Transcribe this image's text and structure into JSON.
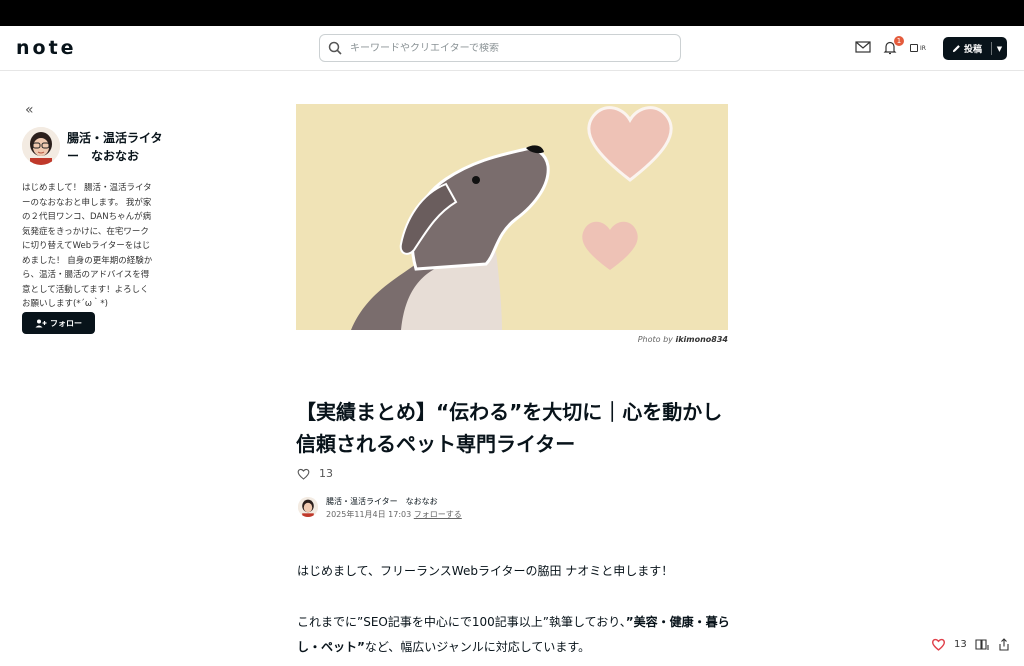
{
  "header": {
    "logo": "note",
    "search_placeholder": "キーワードやクリエイターで検索",
    "notification_count": "1",
    "account_label": "IR",
    "post_label": "投稿"
  },
  "profile": {
    "name": "腸活・温活ライター　なおなお",
    "bio": "はじめまして！ 腸活・温活ライターのなおなおと申します。 我が家の２代目ワンコ、DANちゃんが病気発症をきっかけに、在宅ワークに切り替えてWebライターをはじめました！ 自身の更年期の経験から、温活・腸活のアドバイスを得意として活動してます！よろしくお願いします(*´ω｀*)",
    "follow_label": "フォロー"
  },
  "article": {
    "photo_credit_prefix": "Photo by",
    "photo_credit_user": "ikimono834",
    "title": "【実績まとめ】“伝わる”を大切に｜心を動かし信頼されるペット専門ライター",
    "like_count": "13",
    "author_name": "腸活・温活ライター　なおなお",
    "date": "2025年11月4日 17:03",
    "follow_link": "フォローする",
    "para1": "はじめまして、フリーランスWebライターの脇田 ナオミと申します！",
    "para2_a": "これまでに”SEO記事を中心にで100記事以上”執筆しており、",
    "para2_b": "”美容・健康・暮らし・ペット”",
    "para2_c": "など、幅広いジャンルに対応しています。"
  },
  "floating": {
    "like_count": "13"
  },
  "colors": {
    "hero_bg": "#f0e3b6",
    "dog": "#7a6d6d",
    "heart": "#eec2b6",
    "accent_heart": "#e0404a",
    "dark": "#08131a"
  }
}
